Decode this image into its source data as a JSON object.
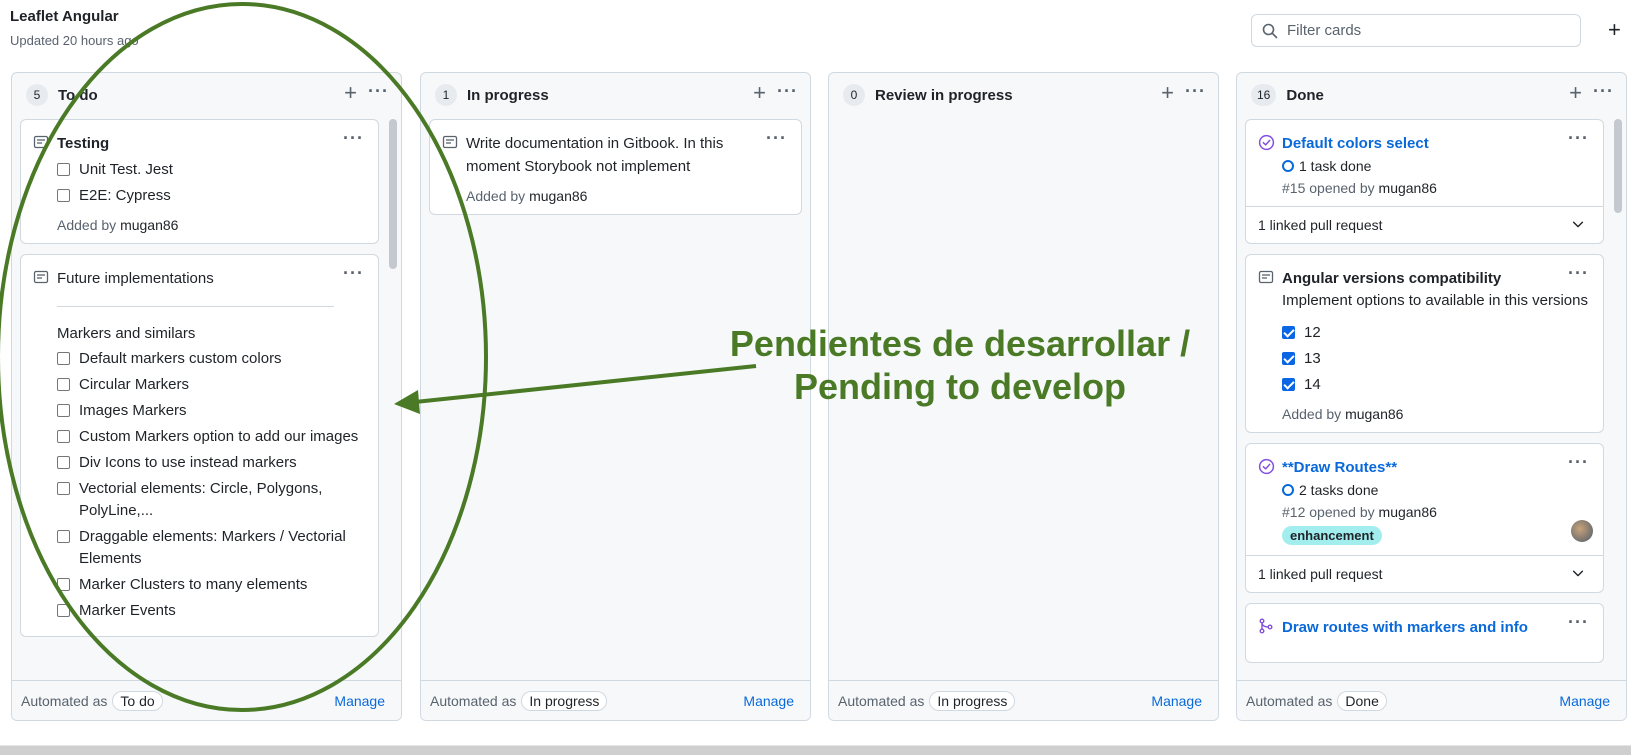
{
  "project": {
    "title": "Leaflet Angular",
    "updated": "Updated 20 hours ago"
  },
  "filter": {
    "placeholder": "Filter cards"
  },
  "icons": {
    "search": "search-icon",
    "note": "note-icon",
    "issue_closed": "issue-closed-icon",
    "pull_request_merged": "pull-request-merged-icon",
    "chevron": "chevron-down-icon",
    "more": "kebab-horizontal-icon",
    "plus": "plus-icon"
  },
  "colors": {
    "annotation": "#4a7a25",
    "link": "#0969da",
    "label_enhancement": "#a2eeef",
    "closed_issue": "#8250df"
  },
  "columns": [
    {
      "count": "5",
      "name": "To do",
      "footer": {
        "prefix": "Automated as",
        "pill": "To do",
        "manage": "Manage"
      },
      "cards": [
        {
          "title": "Testing",
          "checks": [
            "Unit Test. Jest",
            "E2E: Cypress"
          ],
          "added_prefix": "Added by",
          "author": "mugan86"
        },
        {
          "title": "Future implementations",
          "section": "Markers and similars",
          "checks": [
            "Default markers custom colors",
            "Circular Markers",
            "Images Markers",
            "Custom Markers option to add our images",
            "Div Icons to use instead markers",
            "Vectorial elements: Circle, Polygons, PolyLine,...",
            "Draggable elements: Markers / Vectorial Elements",
            "Marker Clusters to many elements",
            "Marker Events"
          ]
        }
      ]
    },
    {
      "count": "1",
      "name": "In progress",
      "footer": {
        "prefix": "Automated as",
        "pill": "In progress",
        "manage": "Manage"
      },
      "cards": [
        {
          "title": "Write documentation in Gitbook. In this moment Storybook not implement",
          "added_prefix": "Added by",
          "author": "mugan86"
        }
      ]
    },
    {
      "count": "0",
      "name": "Review in progress",
      "footer": {
        "prefix": "Automated as",
        "pill": "In progress",
        "manage": "Manage"
      },
      "cards": []
    },
    {
      "count": "16",
      "name": "Done",
      "footer": {
        "prefix": "Automated as",
        "pill": "Done",
        "manage": "Manage"
      },
      "cards": [
        {
          "title": "Default colors select",
          "tasks": "1 task done",
          "opened": "#15 opened by",
          "author": "mugan86",
          "linked": "1 linked pull request"
        },
        {
          "title": "Angular versions compatibility",
          "subtitle": "Implement options to available in this versions",
          "checks": [
            "12",
            "13",
            "14"
          ],
          "added_prefix": "Added by",
          "author": "mugan86"
        },
        {
          "title": "**Draw Routes**",
          "tasks": "2 tasks done",
          "opened": "#12 opened by",
          "author": "mugan86",
          "label": "enhancement",
          "linked": "1 linked pull request"
        },
        {
          "title": "Draw routes with markers and info"
        }
      ]
    }
  ],
  "annotation": {
    "line1": "Pendientes de desarrollar /",
    "line2": "Pending to develop"
  }
}
